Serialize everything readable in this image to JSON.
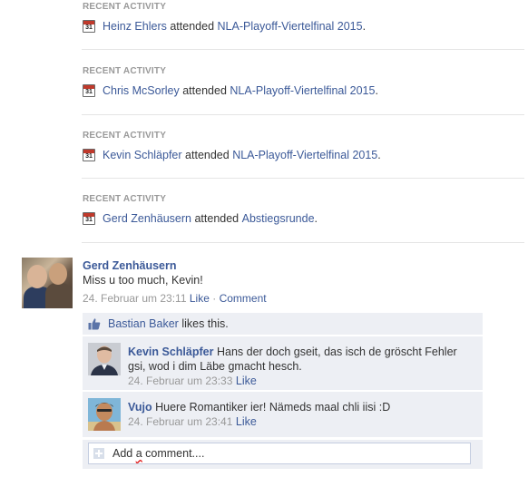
{
  "activities": [
    {
      "label": "RECENT ACTIVITY",
      "icon": "calendar-icon",
      "calendar_day": "31",
      "person": "Heinz Ehlers",
      "verb": "attended",
      "event": "NLA-Playoff-Viertelfinal 2015",
      "end": "."
    },
    {
      "label": "RECENT ACTIVITY",
      "icon": "calendar-icon",
      "calendar_day": "31",
      "person": "Chris McSorley",
      "verb": "attended",
      "event": "NLA-Playoff-Viertelfinal 2015",
      "end": "."
    },
    {
      "label": "RECENT ACTIVITY",
      "icon": "calendar-icon",
      "calendar_day": "31",
      "person": "Kevin Schläpfer",
      "verb": "attended",
      "event": "NLA-Playoff-Viertelfinal 2015",
      "end": "."
    },
    {
      "label": "RECENT ACTIVITY",
      "icon": "calendar-icon",
      "calendar_day": "31",
      "person": "Gerd Zenhäusern",
      "verb": "attended",
      "event": "Abstiegsrunde",
      "end": "."
    }
  ],
  "post": {
    "author": "Gerd Zenhäusern",
    "text": "Miss u too much, Kevin!",
    "timestamp": "24. Februar um 23:11",
    "like_label": "Like",
    "separator": "·",
    "comment_label": "Comment"
  },
  "likes": {
    "icon": "thumbs-up-icon",
    "name": "Bastian Baker",
    "suffix": "likes this."
  },
  "comments": [
    {
      "author": "Kevin Schläpfer",
      "text": "Hans der doch gseit, das isch de gröscht Fehler gsi, wod i dim Läbe gmacht hesch.",
      "timestamp": "24. Februar um 23:33",
      "like_label": "Like"
    },
    {
      "author": "Vujo",
      "text": "Huere Romantiker ier! Nämeds maal chli iisi :D",
      "timestamp": "24. Februar um 23:41",
      "like_label": "Like"
    }
  ],
  "add_comment": {
    "icon": "add-comment-icon",
    "placeholder_pre": "Add ",
    "placeholder_sq": "a",
    "placeholder_post": " comment...."
  },
  "colors": {
    "link": "#3b5998",
    "meta": "#999999",
    "comment_bg": "#edeff4",
    "separator": "#e5e5e5"
  }
}
